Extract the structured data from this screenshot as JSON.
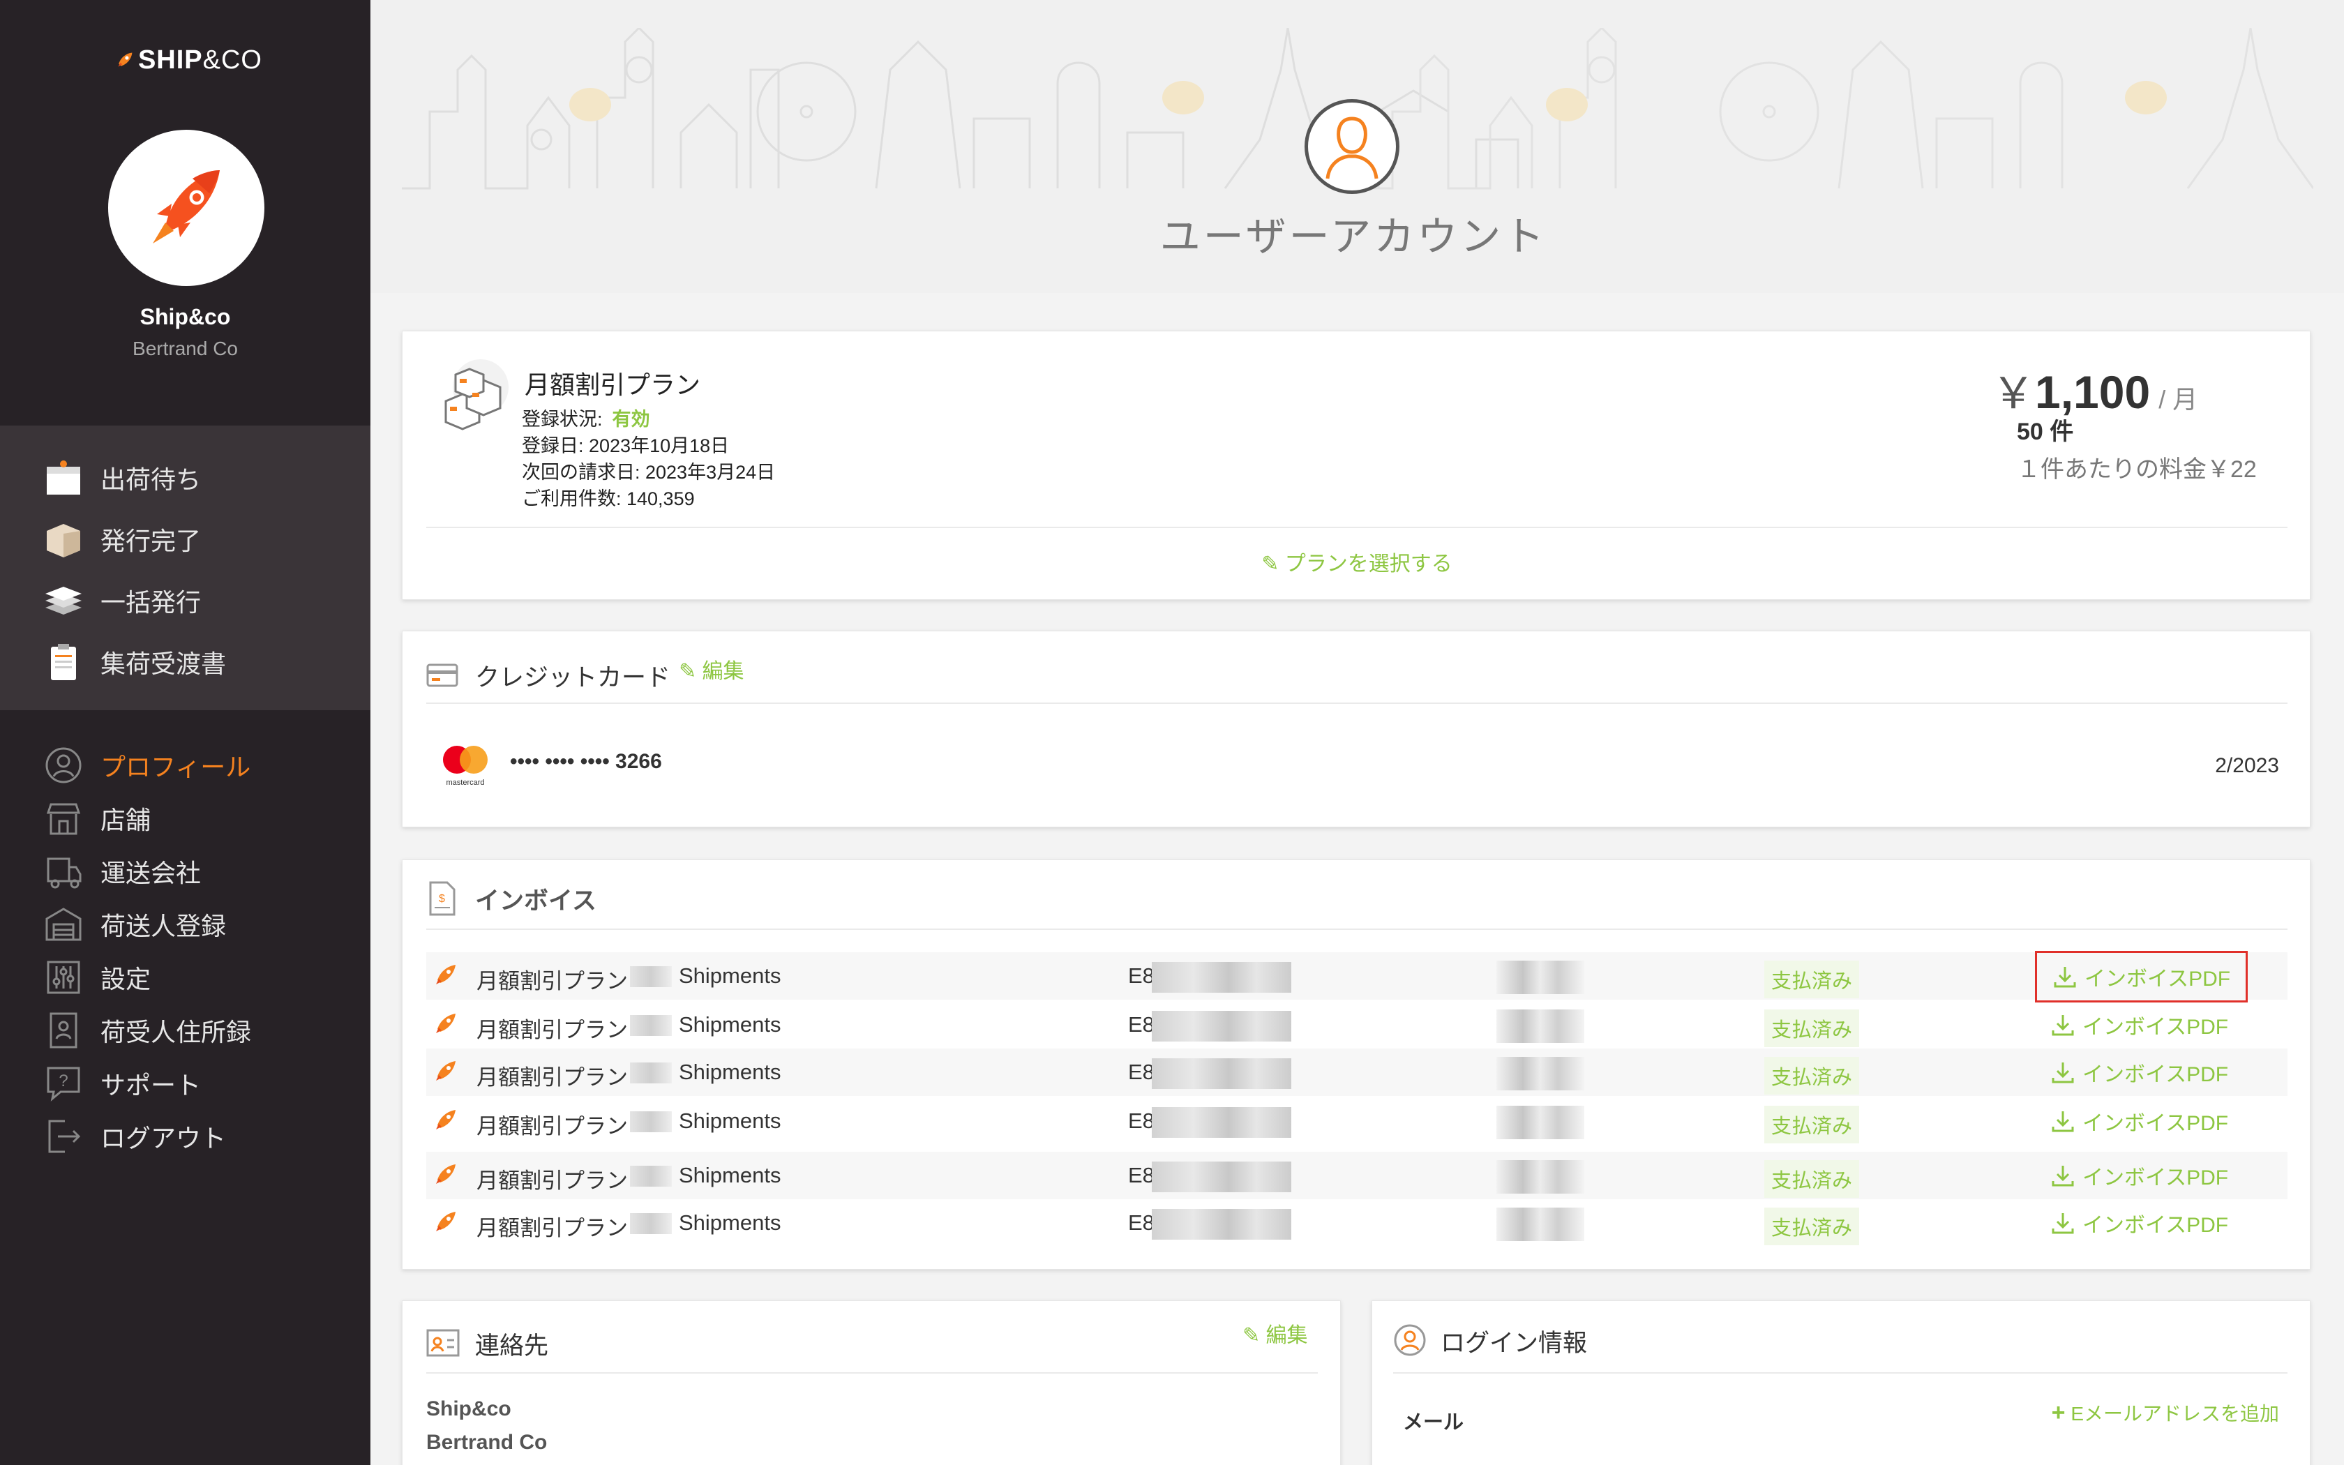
{
  "brand": {
    "logo_text_bold": "SHIP",
    "logo_text_light": "&CO"
  },
  "org": {
    "name": "Ship&co",
    "subtitle": "Bertrand Co"
  },
  "nav_primary": [
    {
      "label": "出荷待ち",
      "icon": "box-icon"
    },
    {
      "label": "発行完了",
      "icon": "package-icon"
    },
    {
      "label": "一括発行",
      "icon": "stack-icon"
    },
    {
      "label": "集荷受渡書",
      "icon": "clipboard-icon"
    }
  ],
  "nav_secondary": [
    {
      "label": "プロフィール",
      "icon": "user-icon",
      "active": true
    },
    {
      "label": "店舗",
      "icon": "store-icon"
    },
    {
      "label": "運送会社",
      "icon": "truck-icon"
    },
    {
      "label": "荷送人登録",
      "icon": "warehouse-icon"
    },
    {
      "label": "設定",
      "icon": "sliders-icon"
    },
    {
      "label": "荷受人住所録",
      "icon": "address-book-icon"
    },
    {
      "label": "サポート",
      "icon": "support-icon"
    },
    {
      "label": "ログアウト",
      "icon": "logout-icon"
    }
  ],
  "page_title": "ユーザーアカウント",
  "plan": {
    "name": "月額割引プラン",
    "status_label": "登録状況:",
    "status_value": "有効",
    "registered": "登録日: 2023年10月18日",
    "next_billing": "次回の請求日: 2023年3月24日",
    "usage": "ご利用件数: 140,359",
    "currency": "￥",
    "price": "1,100",
    "per": "/ 月",
    "count": "50 件",
    "unit_price": "１件あたりの料金￥22",
    "select_label": "プランを選択する"
  },
  "credit_card": {
    "title": "クレジットカード",
    "edit_label": "編集",
    "brand": "mastercard",
    "number": "•••• •••• •••• 3266",
    "expiry": "2/2023"
  },
  "invoices": {
    "title": "インボイス",
    "rows": [
      {
        "description": "月額割引プラン",
        "unit": "Shipments",
        "number_prefix": "E8",
        "status": "支払済み",
        "download_label": "インボイスPDF"
      },
      {
        "description": "月額割引プラン",
        "unit": "Shipments",
        "number_prefix": "E8",
        "status": "支払済み",
        "download_label": "インボイスPDF"
      },
      {
        "description": "月額割引プラン",
        "unit": "Shipments",
        "number_prefix": "E8",
        "status": "支払済み",
        "download_label": "インボイスPDF"
      },
      {
        "description": "月額割引プラン",
        "unit": "Shipments",
        "number_prefix": "E8",
        "status": "支払済み",
        "download_label": "インボイスPDF"
      },
      {
        "description": "月額割引プラン",
        "unit": "Shipments",
        "number_prefix": "E8",
        "status": "支払済み",
        "download_label": "インボイスPDF"
      },
      {
        "description": "月額割引プラン",
        "unit": "Shipments",
        "number_prefix": "E8",
        "status": "支払済み",
        "download_label": "インボイスPDF"
      }
    ]
  },
  "contact": {
    "title": "連絡先",
    "edit_label": "編集",
    "line1": "Ship&co",
    "line2": "Bertrand Co"
  },
  "login": {
    "title": "ログイン情報",
    "email_label": "メール",
    "add_email_label": "Eメールアドレスを追加"
  },
  "colors": {
    "sidebar": "#272226",
    "accent_orange": "#f5821f",
    "accent_green": "#8dc641",
    "highlight": "#e0302a"
  }
}
